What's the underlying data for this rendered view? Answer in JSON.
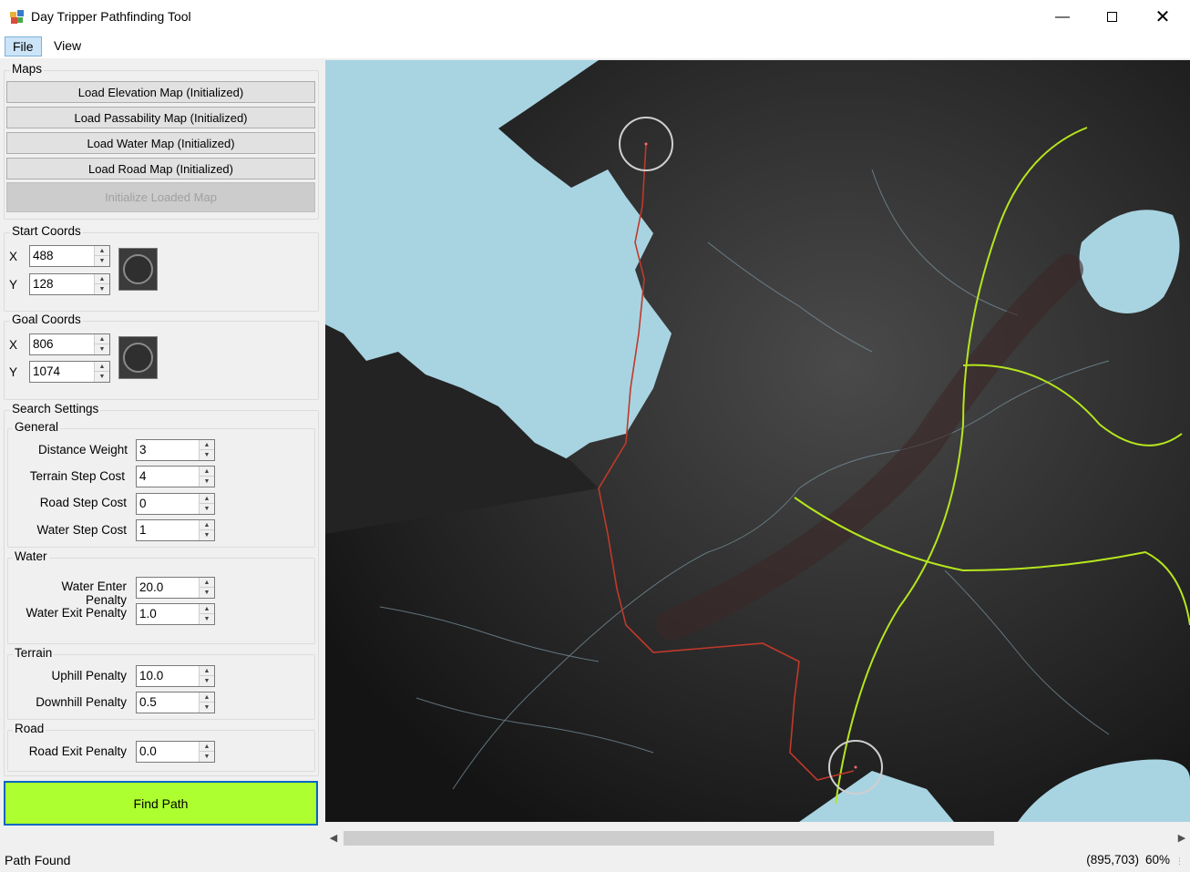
{
  "window": {
    "title": "Day Tripper Pathfinding Tool"
  },
  "menu": {
    "file": "File",
    "view": "View"
  },
  "maps": {
    "group_label": "Maps",
    "load_elevation": "Load Elevation Map (Initialized)",
    "load_passability": "Load Passability Map (Initialized)",
    "load_water": "Load Water Map (Initialized)",
    "load_road": "Load Road Map (Initialized)",
    "initialize": "Initialize Loaded Map"
  },
  "start": {
    "group_label": "Start Coords",
    "x_label": "X",
    "y_label": "Y",
    "x": "488",
    "y": "128"
  },
  "goal": {
    "group_label": "Goal Coords",
    "x_label": "X",
    "y_label": "Y",
    "x": "806",
    "y": "1074"
  },
  "search": {
    "group_label": "Search Settings",
    "general": {
      "label": "General",
      "distance_weight_label": "Distance Weight",
      "distance_weight": "3",
      "terrain_step_label": "Terrain Step Cost",
      "terrain_step": "4",
      "road_step_label": "Road Step Cost",
      "road_step": "0",
      "water_step_label": "Water Step Cost",
      "water_step": "1"
    },
    "water": {
      "label": "Water",
      "enter_label": "Water Enter Penalty",
      "enter": "20.0",
      "exit_label": "Water Exit Penalty",
      "exit": "1.0"
    },
    "terrain": {
      "label": "Terrain",
      "uphill_label": "Uphill Penalty",
      "uphill": "10.0",
      "downhill_label": "Downhill Penalty",
      "downhill": "0.5"
    },
    "road": {
      "label": "Road",
      "exit_label": "Road Exit Penalty",
      "exit": "0.0"
    }
  },
  "find_path": "Find Path",
  "status": {
    "text": "Path Found",
    "coords": "(895,703)",
    "zoom": "60%"
  },
  "colors": {
    "accent": "#adff2f",
    "water": "#a8d4e2",
    "path": "#c0392b",
    "road": "#b5e61d",
    "focus_border": "#0067c0"
  },
  "icons": {
    "minimize": "minimize-icon",
    "maximize": "maximize-icon",
    "close": "close-icon",
    "app": "app-icon"
  }
}
